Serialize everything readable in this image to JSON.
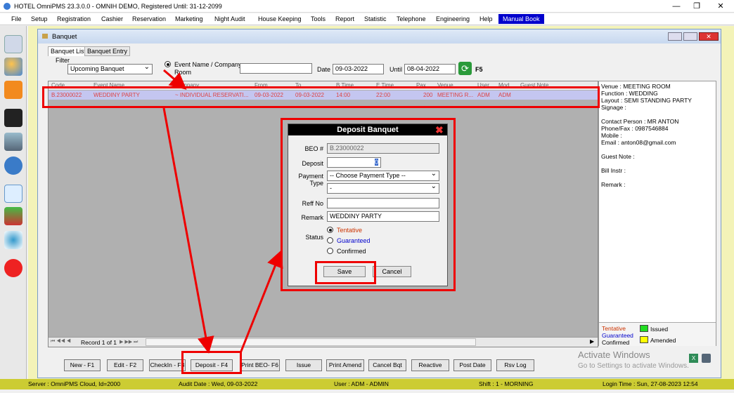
{
  "window": {
    "title": "HOTEL OmniPMS 23.3.0.0 - OMNIH DEMO, Registered Until: 31-12-2099",
    "minimize": "—",
    "maximize": "❐",
    "close": "✕"
  },
  "menu": [
    "File",
    "Setup",
    "Registration",
    "Cashier",
    "Reservation",
    "Marketing",
    "Night Audit",
    "House Keeping",
    "Tools",
    "Report",
    "Statistic",
    "Telephone",
    "Engineering",
    "Help",
    "Manual Book"
  ],
  "banquet": {
    "title": "Banquet",
    "tabs": [
      "Banquet List",
      "Banquet Entry"
    ],
    "filter_label": "Filter",
    "filter_value": "Upcoming Banquet",
    "radio_label_line1": "Event Name / Company",
    "radio_label_line2": "Room",
    "search_value": "",
    "date_label": "Date",
    "date_value": "09-03-2022",
    "until_label": "Until",
    "until_value": "08-04-2022",
    "refresh_label": "F5"
  },
  "grid": {
    "headers": [
      "Code",
      "Event Name",
      "Company",
      "From",
      "To",
      "B.Time",
      "E.Time",
      "Pax",
      "Venue",
      "User",
      "Mod",
      "Guest Note"
    ],
    "row": [
      "B.23000022",
      "WEDDINY PARTY",
      "~ INDIVIDUAL RESERVATI...",
      "09-03-2022",
      "09-03-2022",
      "14:00",
      "22:00",
      "200",
      "MEETING R...",
      "ADM",
      "ADM",
      ""
    ]
  },
  "info": {
    "venue": "Venue : MEETING ROOM",
    "function": "Function : WEDDING",
    "layout": "Layout : SEMI STANDING PARTY",
    "signage": "Signage :",
    "contact": "Contact Person : MR ANTON",
    "phone": "Phone/Fax : 0987546884",
    "mobile": "Mobile :",
    "email": "Email : anton08@gmail.com",
    "guest_note": "Guest Note :",
    "bill_instr": "Bill Instr :",
    "remark": "Remark :",
    "legend_tentative": "Tentative",
    "legend_guaranteed": "Guaranteed",
    "legend_confirmed": "Confirmed",
    "legend_issued": "Issued",
    "legend_amended": "Amended"
  },
  "nav": {
    "record": "Record 1 of 1"
  },
  "buttons": [
    "New - F1",
    "Edit - F2",
    "CheckIn - F3",
    "Deposit - F4",
    "Print BEO- F6",
    "Issue",
    "Print Amend",
    "Cancel Bqt",
    "Reactive",
    "Post Date",
    "Rsv Log"
  ],
  "watermark": {
    "line1": "Activate Windows",
    "line2": "Go to Settings to activate Windows."
  },
  "status": {
    "server": "Server : OmniPMS Cloud, Id=2000",
    "audit": "Audit Date : Wed, 09-03-2022",
    "user": "User : ADM - ADMIN",
    "shift": "Shift : 1 - MORNING",
    "login": "Login Time : Sun, 27-08-2023 12:54"
  },
  "dialog": {
    "title": "Deposit Banquet",
    "beo_label": "BEO #",
    "beo_value": "B.23000022",
    "deposit_label": "Deposit",
    "deposit_value": "0",
    "payment_label": "Payment",
    "type_label": "Type",
    "payment_value": "-- Choose Payment Type --",
    "type_value": "-",
    "reff_label": "Reff No",
    "reff_value": "",
    "remark_label": "Remark",
    "remark_value": "WEDDINY PARTY",
    "status_label": "Status",
    "status_tentative": "Tentative",
    "status_guaranteed": "Guaranteed",
    "status_confirmed": "Confirmed",
    "save": "Save",
    "cancel": "Cancel"
  },
  "colors": {
    "highlight": "#ee0000",
    "menu_active": "#0000cc",
    "tentative": "#cc3300",
    "guaranteed": "#0000cc",
    "status_bar": "#cccc33"
  }
}
